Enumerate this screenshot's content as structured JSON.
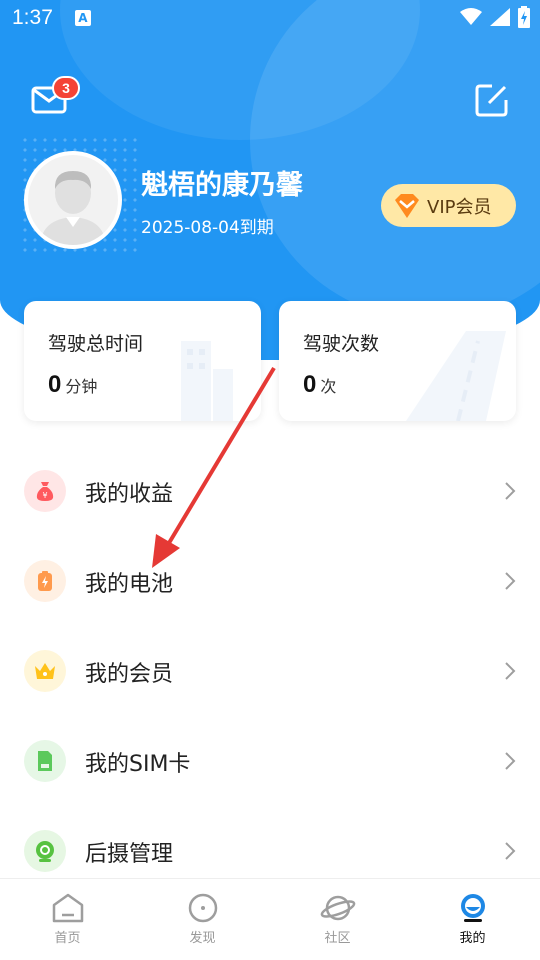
{
  "status_bar": {
    "time": "1:37",
    "notification_icon": "A"
  },
  "header": {
    "mail_badge": "3",
    "username": "魁梧的康乃馨",
    "expiry": "2025-08-04到期",
    "vip_label": "VIP会员"
  },
  "stats": [
    {
      "title": "驾驶总时间",
      "value": "0",
      "unit": "分钟"
    },
    {
      "title": "驾驶次数",
      "value": "0",
      "unit": "次"
    }
  ],
  "menu": [
    {
      "label": "我的收益",
      "icon": "money-bag-icon",
      "color": "#ff5a5f",
      "bg": "#ffe6e6"
    },
    {
      "label": "我的电池",
      "icon": "battery-icon",
      "color": "#ff9a4d",
      "bg": "#fff0e3"
    },
    {
      "label": "我的会员",
      "icon": "crown-icon",
      "color": "#ffc21a",
      "bg": "#fff6d9"
    },
    {
      "label": "我的SIM卡",
      "icon": "sim-card-icon",
      "color": "#5cc95c",
      "bg": "#e6f7e6"
    },
    {
      "label": "后摄管理",
      "icon": "rear-camera-icon",
      "color": "#57c241",
      "bg": "#e6f7e3"
    }
  ],
  "tabs": [
    {
      "label": "首页",
      "icon": "home-icon"
    },
    {
      "label": "发现",
      "icon": "discover-icon"
    },
    {
      "label": "社区",
      "icon": "planet-icon"
    },
    {
      "label": "我的",
      "icon": "profile-icon",
      "active": true
    }
  ],
  "colors": {
    "primary": "#2196f3",
    "vip_bg": "#ffe8a6",
    "arrow": "#e53935",
    "badge": "#f44336"
  }
}
